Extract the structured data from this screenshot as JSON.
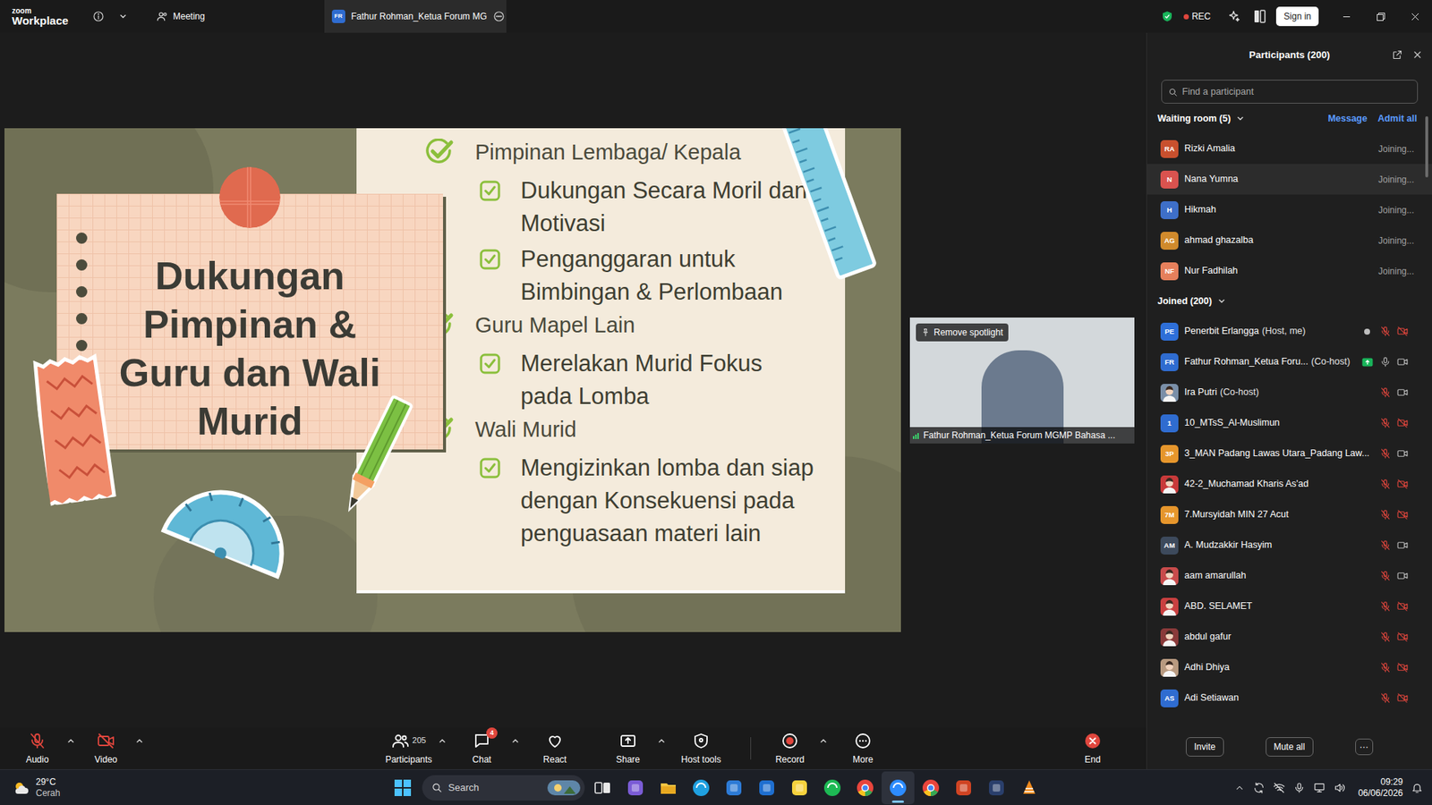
{
  "window": {
    "app_small": "zoom",
    "app": "Workplace",
    "meeting_label": "Meeting",
    "tab": {
      "avatar": "FR",
      "title": "Fathur Rohman_Ketua Forum MG",
      "selected": true
    },
    "recording": {
      "on": true,
      "label": "REC"
    },
    "sign_in": "Sign in"
  },
  "slide": {
    "title_lines": [
      "Dukungan",
      "Pimpinan &",
      "Guru dan Wali",
      "Murid"
    ],
    "items": [
      {
        "kind": "main",
        "lines": [
          "Pimpinan Lembaga/ Kepala"
        ]
      },
      {
        "kind": "sub",
        "lines": [
          "Dukungan Secara Moril dan",
          "Motivasi"
        ]
      },
      {
        "kind": "sub",
        "lines": [
          "Penganggaran untuk",
          "Bimbingan & Perlombaan"
        ]
      },
      {
        "kind": "main",
        "lines": [
          "Guru Mapel Lain"
        ]
      },
      {
        "kind": "sub",
        "lines": [
          "Merelakan Murid Fokus",
          "pada Lomba"
        ]
      },
      {
        "kind": "main",
        "lines": [
          "Wali Murid"
        ]
      },
      {
        "kind": "sub",
        "lines": [
          "Mengizinkan lomba dan siap",
          "dengan Konsekuensi pada",
          "penguasaan materi lain"
        ]
      }
    ]
  },
  "spotlight": {
    "button": "Remove spotlight",
    "name": "Fathur Rohman_Ketua Forum MGMP Bahasa ..."
  },
  "participants_panel": {
    "title": "Participants (200)",
    "search": {
      "placeholder": "Find a participant"
    },
    "waiting": {
      "label": "Waiting room (5)",
      "expanded": true,
      "actions": [
        "Message",
        "Admit all"
      ],
      "people": [
        {
          "kind": "initials",
          "initials": "RA",
          "name": "Rizki Amalia",
          "status": "Joining...",
          "color": "#c8502e",
          "highlighted": false
        },
        {
          "kind": "initials",
          "initials": "N",
          "name": "Nana Yumna",
          "status": "Joining...",
          "color": "#d9534f",
          "highlighted": true
        },
        {
          "kind": "initials",
          "initials": "H",
          "name": "Hikmah",
          "status": "Joining...",
          "color": "#3e6fc8",
          "highlighted": false
        },
        {
          "kind": "initials",
          "initials": "AG",
          "name": "ahmad ghazalba",
          "status": "Joining...",
          "color": "#d08a2c",
          "highlighted": false
        },
        {
          "kind": "initials",
          "initials": "NF",
          "name": "Nur Fadhilah",
          "status": "Joining...",
          "color": "#e6805c",
          "highlighted": false
        }
      ]
    },
    "joined": {
      "label": "Joined (200)",
      "expanded": true,
      "people": [
        {
          "kind": "initials",
          "initials": "PE",
          "name": "Penerbit Erlangga",
          "role": "(Host, me)",
          "color": "#2e6fd8",
          "status_dot": true,
          "sharing": false,
          "muted": true,
          "video_on": false
        },
        {
          "kind": "initials",
          "initials": "FR",
          "name": "Fathur Rohman_Ketua Foru...",
          "role": "(Co-host)",
          "color": "#2f6cd0",
          "status_dot": false,
          "sharing": true,
          "muted": false,
          "video_on": true
        },
        {
          "kind": "photo",
          "name": "Ira Putri",
          "role": "(Co-host)",
          "color": "#7a8fa8",
          "status_dot": false,
          "sharing": false,
          "muted": true,
          "video_on": true
        },
        {
          "kind": "initials",
          "initials": "1",
          "name": "10_MTsS_Al-Muslimun",
          "color": "#2f6cd0",
          "status_dot": false,
          "sharing": false,
          "muted": true,
          "video_on": false
        },
        {
          "kind": "initials",
          "initials": "3P",
          "name": "3_MAN Padang Lawas Utara_Padang Law...",
          "color": "#e6962c",
          "status_dot": false,
          "sharing": false,
          "muted": true,
          "video_on": true
        },
        {
          "kind": "photo",
          "name": "42-2_Muchamad Kharis As'ad",
          "color": "#c83a3a",
          "status_dot": false,
          "sharing": false,
          "muted": true,
          "video_on": false
        },
        {
          "kind": "initials",
          "initials": "7M",
          "name": "7.Mursyidah MIN 27 Acut",
          "color": "#e6962c",
          "status_dot": false,
          "sharing": false,
          "muted": true,
          "video_on": false
        },
        {
          "kind": "initials",
          "initials": "AM",
          "name": "A. Mudzakkir Hasyim",
          "color": "#3d4a5c",
          "status_dot": false,
          "sharing": false,
          "muted": true,
          "video_on": true
        },
        {
          "kind": "photo",
          "name": "aam amarullah",
          "color": "#c84b4b",
          "status_dot": false,
          "sharing": false,
          "muted": true,
          "video_on": true
        },
        {
          "kind": "photo",
          "name": "ABD. SELAMET",
          "color": "#c94040",
          "status_dot": false,
          "sharing": false,
          "muted": true,
          "video_on": false
        },
        {
          "kind": "photo",
          "name": "abdul gafur",
          "color": "#8a3a3a",
          "status_dot": false,
          "sharing": false,
          "muted": true,
          "video_on": false
        },
        {
          "kind": "photo",
          "name": "Adhi Dhiya",
          "color": "#b89a80",
          "status_dot": false,
          "sharing": false,
          "muted": true,
          "video_on": false
        },
        {
          "kind": "initials",
          "initials": "AS",
          "name": "Adi Setiawan",
          "color": "#2f6cd0",
          "status_dot": false,
          "sharing": false,
          "muted": true,
          "video_on": false
        }
      ]
    },
    "footer": [
      "Invite",
      "Mute all",
      "···"
    ]
  },
  "toolbar": [
    {
      "kind": "audio",
      "label": "Audio",
      "off": true,
      "chevron": true
    },
    {
      "kind": "video",
      "label": "Video",
      "off": true,
      "chevron": true
    },
    {
      "kind": "participants",
      "label": "Participants",
      "count": "205",
      "chevron": true
    },
    {
      "kind": "chat",
      "label": "Chat",
      "badge": "4",
      "chevron": true
    },
    {
      "kind": "react",
      "label": "React",
      "chevron": false
    },
    {
      "kind": "share",
      "label": "Share",
      "chevron": true
    },
    {
      "kind": "host",
      "label": "Host tools",
      "chevron": false
    },
    {
      "kind": "record",
      "label": "Record",
      "chevron": true
    },
    {
      "kind": "more",
      "label": "More",
      "chevron": false
    },
    {
      "kind": "end",
      "label": "End",
      "chevron": false
    }
  ],
  "taskbar": {
    "weather": {
      "temp": "29°C",
      "condition": "Cerah"
    },
    "search": {
      "placeholder": "Search"
    },
    "apps": [
      {
        "kind": "taskview",
        "color": "#e8e8e8",
        "active": false
      },
      {
        "kind": "m365",
        "color": "#7b5cd6",
        "active": false
      },
      {
        "kind": "explorer",
        "color": "#f4c542",
        "active": false
      },
      {
        "kind": "edge",
        "color": "#1fa0e0",
        "active": false
      },
      {
        "kind": "store",
        "color": "#2d7bd6",
        "active": false
      },
      {
        "kind": "outlook",
        "color": "#1f6fd0",
        "active": false
      },
      {
        "kind": "notes",
        "color": "#f7d23e",
        "active": false
      },
      {
        "kind": "spotify",
        "color": "#1db954",
        "active": false
      },
      {
        "kind": "chrome",
        "color": "#e8453c",
        "active": false
      },
      {
        "kind": "zoom",
        "color": "#2d8cff",
        "active": true
      },
      {
        "kind": "chrome",
        "color": "#e8453c",
        "active": false
      },
      {
        "kind": "powerpoint",
        "color": "#d04423",
        "active": false
      },
      {
        "kind": "photoshop",
        "color": "#2a3f6c",
        "active": false
      },
      {
        "kind": "vlc",
        "color": "#f08a1c",
        "active": false
      }
    ],
    "clock": {
      "time": "09:29",
      "date": "06/06/2026"
    }
  }
}
